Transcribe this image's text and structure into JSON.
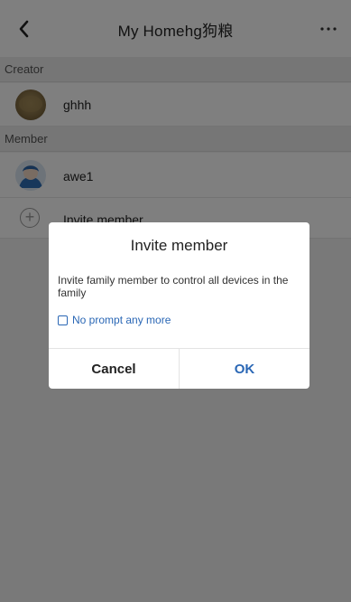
{
  "header": {
    "title": "My Homehg狗粮"
  },
  "sections": {
    "creator": "Creator",
    "member": "Member"
  },
  "creator": {
    "name": "ghhh"
  },
  "member": {
    "name": "awe1"
  },
  "invite_row": {
    "label": "Invite member"
  },
  "dialog": {
    "title": "Invite member",
    "message": "Invite family member to control all devices in the family",
    "checkbox_label": "No prompt any more",
    "cancel": "Cancel",
    "ok": "OK"
  },
  "icons": {
    "back": "chevron-left-icon",
    "more": "more-icon",
    "add": "plus-circle-icon",
    "creator_avatar": "avatar-photo",
    "member_avatar": "avatar-person"
  },
  "colors": {
    "accent": "#2a67b5"
  }
}
